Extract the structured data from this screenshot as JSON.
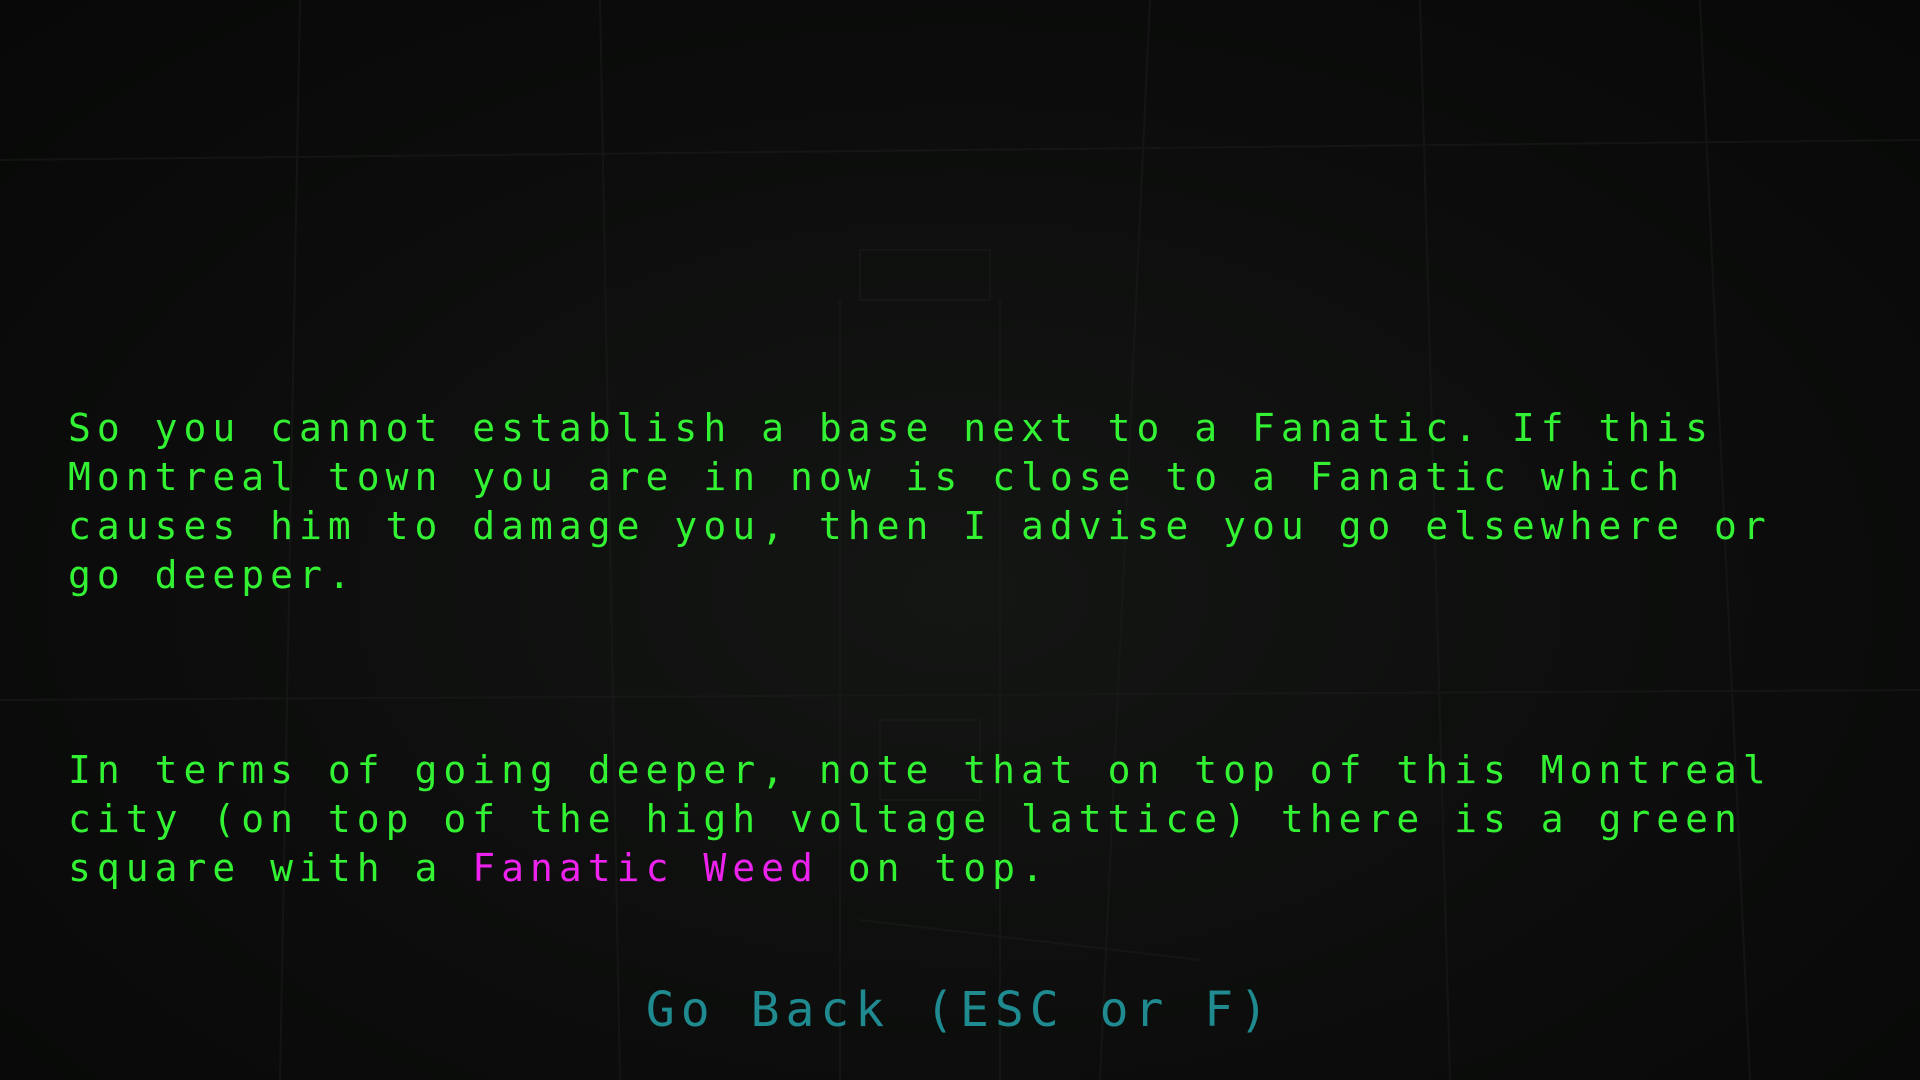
{
  "dialog": {
    "paragraph1": "So you cannot establish a base next to a Fanatic. If this\nMontreal town you are in now is close to a Fanatic which\ncauses him to damage you, then I advise you go elsewhere or\ngo deeper.",
    "paragraph2_before": "In terms of going deeper, note that on top of this Montreal\ncity (on top of the high voltage lattice) there is a green\nsquare with a ",
    "paragraph2_highlight": "Fanatic Weed",
    "paragraph2_after": " on top."
  },
  "footer": {
    "go_back_label": "Go Back (ESC or F)"
  },
  "colors": {
    "dialog_text": "#33f233",
    "highlight": "#ee22ee",
    "go_back": "#1f8a8f",
    "background": "#0a0b0a"
  }
}
